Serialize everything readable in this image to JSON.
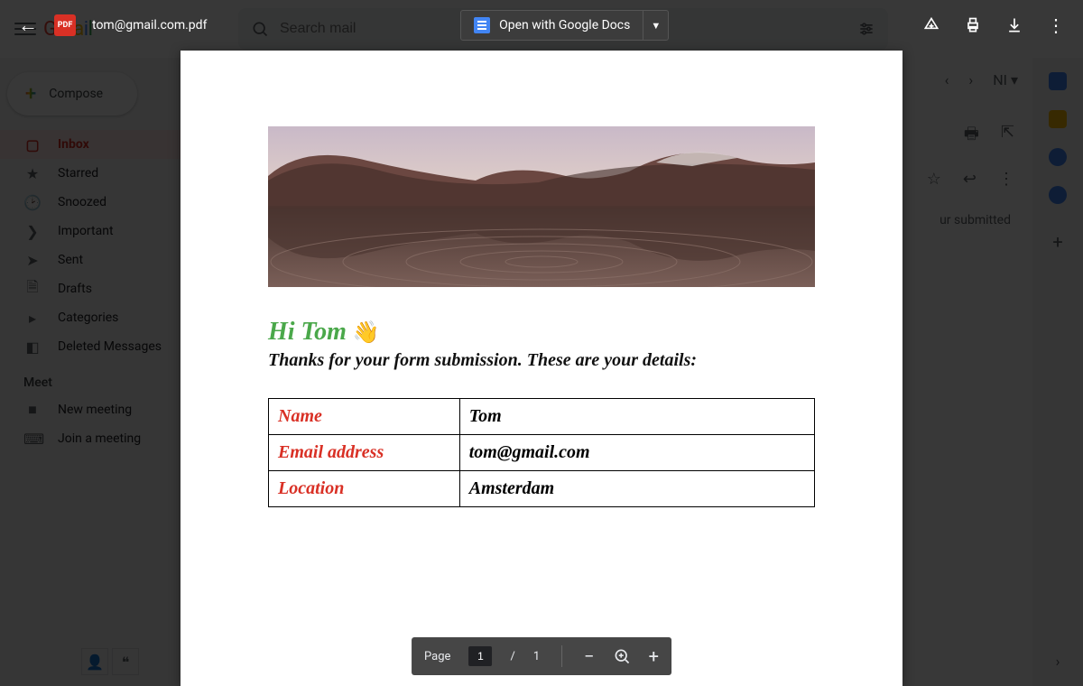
{
  "gmail": {
    "search_placeholder": "Search mail",
    "compose": "Compose",
    "nav": [
      {
        "label": "Inbox",
        "active": true
      },
      {
        "label": "Starred"
      },
      {
        "label": "Snoozed"
      },
      {
        "label": "Important"
      },
      {
        "label": "Sent"
      },
      {
        "label": "Drafts"
      },
      {
        "label": "Categories"
      },
      {
        "label": "Deleted Messages"
      }
    ],
    "meet_header": "Meet",
    "meet": [
      {
        "label": "New meeting"
      },
      {
        "label": "Join a meeting"
      }
    ],
    "pager_label": "NI",
    "email_snippet": "ur submitted"
  },
  "viewer": {
    "filename": "tom@gmail.com.pdf",
    "pdf_badge": "PDF",
    "open_with": "Open with Google Docs",
    "page_label": "Page",
    "page_current": "1",
    "page_sep": "/",
    "page_total": "1"
  },
  "document": {
    "greeting_hi": "Hi Tom ",
    "greeting_wave": "👋",
    "thanks": "Thanks for your form submission. These are your details:",
    "fields": [
      {
        "label": "Name",
        "value": "Tom"
      },
      {
        "label": "Email address",
        "value": "tom@gmail.com"
      },
      {
        "label": "Location",
        "value": "Amsterdam"
      }
    ]
  }
}
